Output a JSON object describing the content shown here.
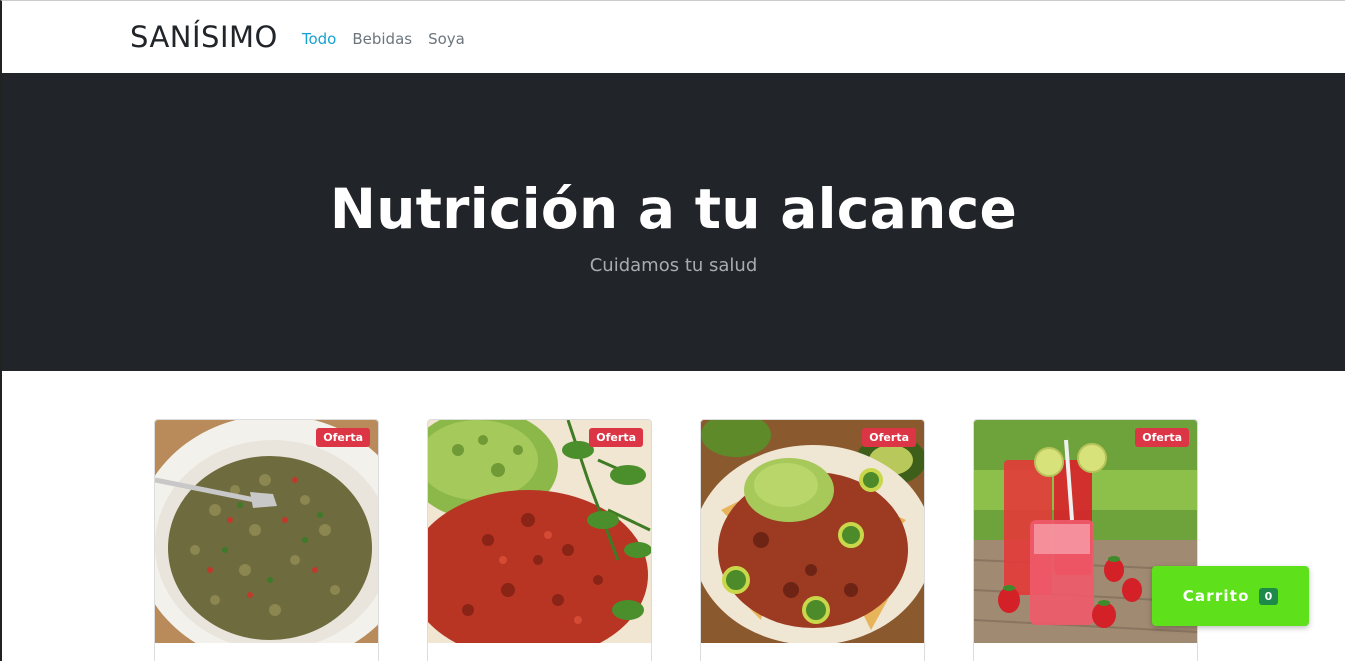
{
  "navbar": {
    "brand": "SANÍSIMO",
    "links": [
      {
        "label": "Todo",
        "active": true
      },
      {
        "label": "Bebidas",
        "active": false
      },
      {
        "label": "Soya",
        "active": false
      }
    ]
  },
  "hero": {
    "title": "Nutrición a tu alcance",
    "subtitle": "Cuidamos tu salud"
  },
  "products": [
    {
      "badge": "Oferta",
      "image": "lentil-salad-image"
    },
    {
      "badge": "Oferta",
      "image": "guacamole-chorizo-soya-image"
    },
    {
      "badge": "Oferta",
      "image": "nachos-image"
    },
    {
      "badge": "Oferta",
      "image": "strawberry-drink-image"
    }
  ],
  "cart": {
    "label": "Carrito",
    "count": "0"
  },
  "colors": {
    "active_link": "#17a2d0",
    "hero_bg": "#212429",
    "badge": "#dc3545",
    "cart_bg": "#5ee01a",
    "cart_count_bg": "#1e8a4a"
  }
}
